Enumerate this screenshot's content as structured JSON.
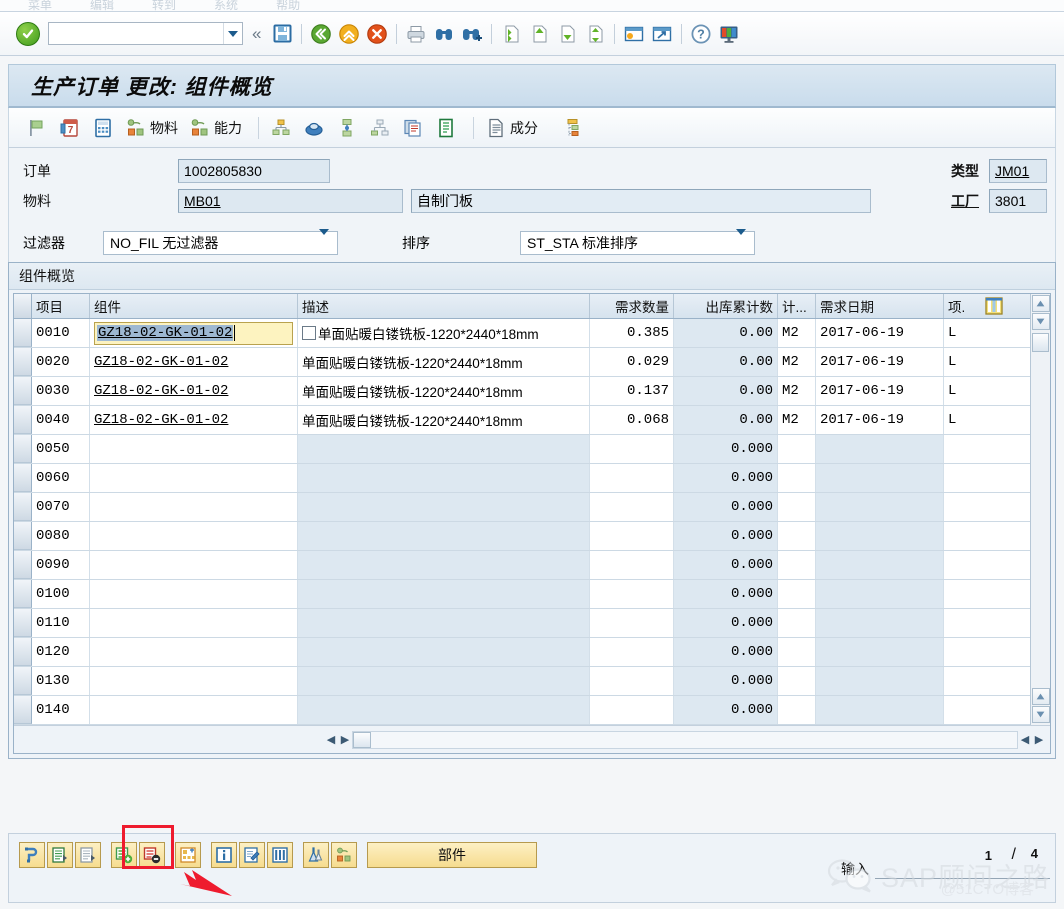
{
  "menubar": {
    "items": [
      "菜单",
      "编辑",
      "转到",
      "系统",
      "帮助"
    ]
  },
  "systoolbar": {
    "ok_icon": "ok-check-icon",
    "command_field_value": "",
    "command_field_placeholder": "",
    "buttons": [
      {
        "name": "back-collapse-icon",
        "label": "«"
      },
      {
        "name": "save-icon",
        "label": "保存"
      },
      {
        "name": "back-icon",
        "label": "后退"
      },
      {
        "name": "exit-icon",
        "label": "退出"
      },
      {
        "name": "cancel-icon",
        "label": "取消"
      },
      {
        "name": "print-icon",
        "label": "打印"
      },
      {
        "name": "find-icon",
        "label": "查找"
      },
      {
        "name": "find-next-icon",
        "label": "查找下一个"
      },
      {
        "name": "first-page-icon",
        "label": "第一页"
      },
      {
        "name": "previous-page-icon",
        "label": "上一页"
      },
      {
        "name": "next-page-icon",
        "label": "下一页"
      },
      {
        "name": "last-page-icon",
        "label": "最后一页"
      },
      {
        "name": "create-session-icon",
        "label": "创建新会话"
      },
      {
        "name": "create-shortcut-icon",
        "label": "创建快捷方式"
      },
      {
        "name": "help-icon",
        "label": "帮助"
      },
      {
        "name": "customize-layout-icon",
        "label": "自定义本地布局"
      }
    ]
  },
  "page": {
    "title": "生产订单 更改: 组件概览"
  },
  "apptoolbar": {
    "buttons": [
      {
        "name": "flag-icon",
        "label": ""
      },
      {
        "name": "date-icon",
        "label": ""
      },
      {
        "name": "calculator-icon",
        "label": ""
      },
      {
        "name": "material-icon",
        "label": "物料"
      },
      {
        "name": "capacity-icon",
        "label": "能力"
      },
      {
        "name": "hierarchy-icon",
        "label": ""
      },
      {
        "name": "pot-icon",
        "label": ""
      },
      {
        "name": "sequence-icon",
        "label": ""
      },
      {
        "name": "network-icon",
        "label": ""
      },
      {
        "name": "documents-icon",
        "label": ""
      },
      {
        "name": "list-document-icon",
        "label": ""
      },
      {
        "name": "composition-icon",
        "label": "成分"
      },
      {
        "name": "settings-items-icon",
        "label": ""
      }
    ]
  },
  "form": {
    "order_label": "订单",
    "order_value": "1002805830",
    "type_label": "类型",
    "type_value": "JM01",
    "material_label": "物料",
    "material_value": "MB01",
    "material_desc": "自制门板",
    "plant_label": "工厂",
    "plant_value": "3801"
  },
  "filters": {
    "filter_label": "过滤器",
    "filter_value": "NO_FIL 无过滤器",
    "sort_label": "排序",
    "sort_value": "ST_STA 标准排序"
  },
  "table": {
    "caption": "组件概览",
    "columns": [
      {
        "key": "item",
        "label": "项目"
      },
      {
        "key": "component",
        "label": "组件"
      },
      {
        "key": "description",
        "label": "描述"
      },
      {
        "key": "req_qty",
        "label": "需求数量"
      },
      {
        "key": "withdrawn_qty",
        "label": "出库累计数"
      },
      {
        "key": "uom",
        "label": "计..."
      },
      {
        "key": "req_date",
        "label": "需求日期"
      },
      {
        "key": "item_cat",
        "label": "项."
      }
    ],
    "config_icon": "table-settings-icon",
    "rows": [
      {
        "item": "0010",
        "component": "GZ18-02-GK-01-02",
        "description": "单面贴暖白镂铣板-1220*2440*18mm",
        "req_qty": "0.385",
        "withdrawn_qty": "0.00",
        "uom": "M2",
        "req_date": "2017-06-19",
        "item_cat": "L",
        "selected": true
      },
      {
        "item": "0020",
        "component": "GZ18-02-GK-01-02",
        "description": "单面贴暖白镂铣板-1220*2440*18mm",
        "req_qty": "0.029",
        "withdrawn_qty": "0.00",
        "uom": "M2",
        "req_date": "2017-06-19",
        "item_cat": "L",
        "selected": false
      },
      {
        "item": "0030",
        "component": "GZ18-02-GK-01-02",
        "description": "单面贴暖白镂铣板-1220*2440*18mm",
        "req_qty": "0.137",
        "withdrawn_qty": "0.00",
        "uom": "M2",
        "req_date": "2017-06-19",
        "item_cat": "L",
        "selected": false
      },
      {
        "item": "0040",
        "component": "GZ18-02-GK-01-02",
        "description": "单面贴暖白镂铣板-1220*2440*18mm",
        "req_qty": "0.068",
        "withdrawn_qty": "0.00",
        "uom": "M2",
        "req_date": "2017-06-19",
        "item_cat": "L",
        "selected": false
      },
      {
        "item": "0050",
        "component": "",
        "description": "",
        "req_qty": "",
        "withdrawn_qty": "0.000",
        "uom": "",
        "req_date": "",
        "item_cat": "",
        "selected": false
      },
      {
        "item": "0060",
        "component": "",
        "description": "",
        "req_qty": "",
        "withdrawn_qty": "0.000",
        "uom": "",
        "req_date": "",
        "item_cat": "",
        "selected": false
      },
      {
        "item": "0070",
        "component": "",
        "description": "",
        "req_qty": "",
        "withdrawn_qty": "0.000",
        "uom": "",
        "req_date": "",
        "item_cat": "",
        "selected": false
      },
      {
        "item": "0080",
        "component": "",
        "description": "",
        "req_qty": "",
        "withdrawn_qty": "0.000",
        "uom": "",
        "req_date": "",
        "item_cat": "",
        "selected": false
      },
      {
        "item": "0090",
        "component": "",
        "description": "",
        "req_qty": "",
        "withdrawn_qty": "0.000",
        "uom": "",
        "req_date": "",
        "item_cat": "",
        "selected": false
      },
      {
        "item": "0100",
        "component": "",
        "description": "",
        "req_qty": "",
        "withdrawn_qty": "0.000",
        "uom": "",
        "req_date": "",
        "item_cat": "",
        "selected": false
      },
      {
        "item": "0110",
        "component": "",
        "description": "",
        "req_qty": "",
        "withdrawn_qty": "0.000",
        "uom": "",
        "req_date": "",
        "item_cat": "",
        "selected": false
      },
      {
        "item": "0120",
        "component": "",
        "description": "",
        "req_qty": "",
        "withdrawn_qty": "0.000",
        "uom": "",
        "req_date": "",
        "item_cat": "",
        "selected": false
      },
      {
        "item": "0130",
        "component": "",
        "description": "",
        "req_qty": "",
        "withdrawn_qty": "0.000",
        "uom": "",
        "req_date": "",
        "item_cat": "",
        "selected": false
      },
      {
        "item": "0140",
        "component": "",
        "description": "",
        "req_qty": "",
        "withdrawn_qty": "0.000",
        "uom": "",
        "req_date": "",
        "item_cat": "",
        "selected": false
      }
    ]
  },
  "bottombar": {
    "buttons": [
      {
        "name": "component-allocation-icon",
        "label": ""
      },
      {
        "name": "detail-list-icon",
        "label": ""
      },
      {
        "name": "detail-list-2-icon",
        "label": ""
      },
      {
        "name": "insert-row-icon",
        "label": ""
      },
      {
        "name": "delete-row-icon",
        "label": ""
      },
      {
        "name": "reassign-icon",
        "label": ""
      },
      {
        "name": "info-icon",
        "label": ""
      },
      {
        "name": "edit-icon",
        "label": ""
      },
      {
        "name": "columns-icon",
        "label": ""
      },
      {
        "name": "batch-icon",
        "label": ""
      },
      {
        "name": "material-component-icon",
        "label": ""
      }
    ],
    "wide_button_label": "部件",
    "highlight_target": "insert-row-icon"
  },
  "footer": {
    "entry_label": "输入",
    "current_page": "1",
    "separator": "/",
    "total_pages": "4"
  },
  "watermark": {
    "brand": "SAP顾问之路",
    "source": "@51CTO博客",
    "logo": "wechat-icon"
  },
  "colors": {
    "accent": "#1c5b8c",
    "title_bg": "#cfe0ee",
    "edit_cell": "#fdf3c0",
    "selection": "#9db8d2",
    "highlight_red": "#ee1b2e",
    "button_yellow": "#f6dc8f"
  }
}
